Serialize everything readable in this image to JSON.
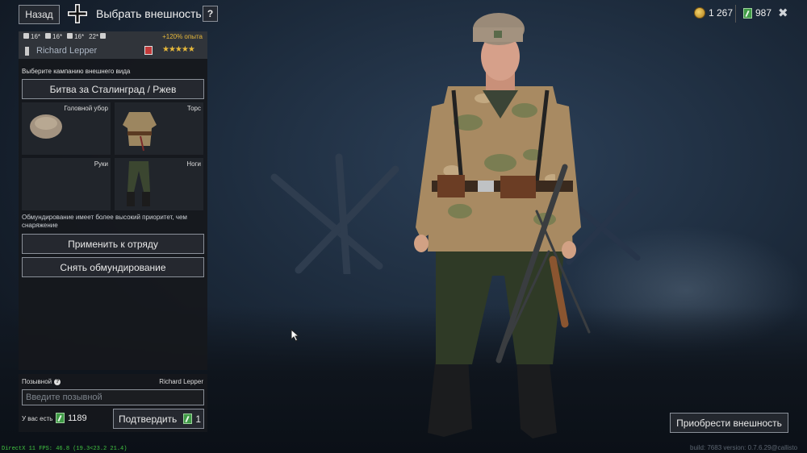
{
  "header": {
    "back_label": "Назад",
    "title": "Выбрать внешность",
    "help_label": "?",
    "gold": "1 267",
    "silver": "987",
    "close_label": "✖"
  },
  "soldier": {
    "stat1": "16",
    "stat2": "16",
    "stat3": "16",
    "stat4": "22",
    "exp_bonus": "+120% опыта",
    "name": "Richard Lepper",
    "stars": "★★★★★"
  },
  "appearance": {
    "campaign_section_label": "Выберите кампанию внешнего вида",
    "campaign": "Битва за Сталинград / Ржев",
    "slots": [
      {
        "label": "Головной убор"
      },
      {
        "label": "Торс"
      },
      {
        "label": "Руки"
      },
      {
        "label": "Ноги"
      }
    ],
    "note": "Обмундирование имеет более высокий приоритет, чем снаряжение",
    "apply_label": "Применить к отряду",
    "remove_label": "Снять обмундирование"
  },
  "callsign": {
    "label": "Позывной",
    "current_name": "Richard Lepper",
    "placeholder": "Введите позывной",
    "have_label": "У вас есть",
    "have_value": "1189",
    "confirm_label": "Подтвердить",
    "confirm_cost": "1"
  },
  "footer": {
    "buy_label": "Приобрести внешность",
    "fps": "DirectX 11 FPS: 46.8 (19.3<23.2 21.4)",
    "build": "build: 7683 version: 0.7.6.29@callisto"
  }
}
